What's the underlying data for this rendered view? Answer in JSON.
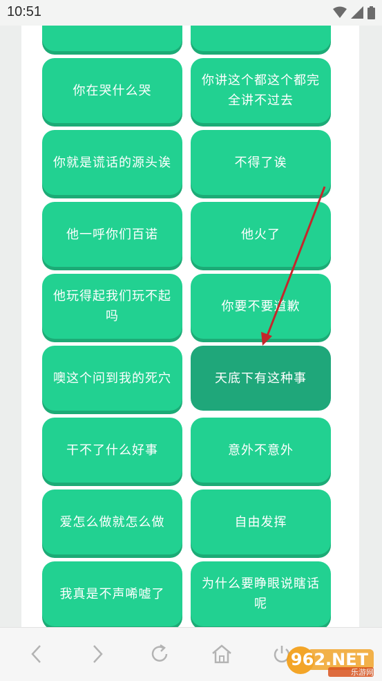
{
  "status_bar": {
    "time": "10:51"
  },
  "phrases": [
    {
      "text": ""
    },
    {
      "text": ""
    },
    {
      "text": "你在哭什么哭"
    },
    {
      "text": "你讲这个都这个都完全讲不过去"
    },
    {
      "text": "你就是谎话的源头诶"
    },
    {
      "text": "不得了诶"
    },
    {
      "text": "他一呼你们百诺"
    },
    {
      "text": "他火了"
    },
    {
      "text": "他玩得起我们玩不起吗"
    },
    {
      "text": "你要不要道歉"
    },
    {
      "text": "噢这个问到我的死穴"
    },
    {
      "text": "天底下有这种事"
    },
    {
      "text": "干不了什么好事"
    },
    {
      "text": "意外不意外"
    },
    {
      "text": "爱怎么做就怎么做"
    },
    {
      "text": "自由发挥"
    },
    {
      "text": "我真是不声唏嘘了"
    },
    {
      "text": "为什么要睁眼说瞎话呢"
    },
    {
      "text": ""
    },
    {
      "text": ""
    }
  ],
  "nav": {
    "items": [
      "back-icon",
      "forward-icon",
      "refresh-icon",
      "home-icon",
      "power-icon"
    ]
  },
  "watermark": {
    "logo": "962.NET",
    "subtitle": "乐游网"
  },
  "colors": {
    "button": "#22d191",
    "button_shadow": "#1cab76",
    "button_active": "#1fa77a",
    "arrow": "#c4262b"
  }
}
